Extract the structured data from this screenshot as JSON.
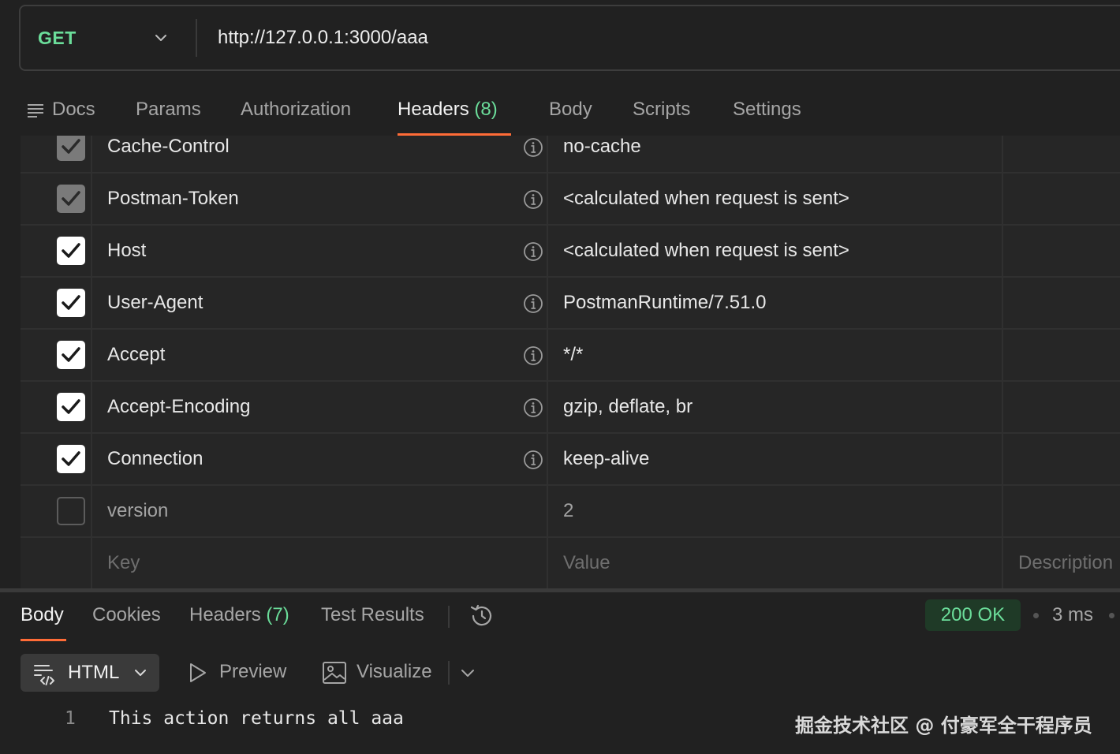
{
  "request": {
    "method": "GET",
    "url": "http://127.0.0.1:3000/aaa"
  },
  "request_tabs": {
    "docs": "Docs",
    "params": "Params",
    "authorization": "Authorization",
    "headers": "Headers",
    "headers_count": "(8)",
    "body": "Body",
    "scripts": "Scripts",
    "settings": "Settings"
  },
  "headers_table": {
    "rows": [
      {
        "key": "Cache-Control",
        "value": "no-cache",
        "state": "locked"
      },
      {
        "key": "Postman-Token",
        "value": "<calculated when request is sent>",
        "state": "locked"
      },
      {
        "key": "Host",
        "value": "<calculated when request is sent>",
        "state": "on"
      },
      {
        "key": "User-Agent",
        "value": "PostmanRuntime/7.51.0",
        "state": "on"
      },
      {
        "key": "Accept",
        "value": "*/*",
        "state": "on"
      },
      {
        "key": "Accept-Encoding",
        "value": "gzip, deflate, br",
        "state": "on"
      },
      {
        "key": "Connection",
        "value": "keep-alive",
        "state": "on"
      },
      {
        "key": "version",
        "value": "2",
        "state": "off"
      }
    ],
    "placeholder": {
      "key": "Key",
      "value": "Value",
      "description": "Description"
    }
  },
  "response_tabs": {
    "body": "Body",
    "cookies": "Cookies",
    "headers": "Headers",
    "headers_count": "(7)",
    "test_results": "Test Results"
  },
  "response_status": {
    "status": "200 OK",
    "time": "3 ms"
  },
  "response_toolbar": {
    "format": "HTML",
    "preview": "Preview",
    "visualize": "Visualize"
  },
  "response_body": {
    "lines": [
      {
        "number": "1",
        "text": "This action returns all aaa"
      }
    ]
  },
  "watermark": "掘金技术社区 @ 付豪军全干程序员",
  "colors": {
    "accent": "#ff6c37",
    "method_green": "#6bdd9a",
    "background": "#212121"
  }
}
